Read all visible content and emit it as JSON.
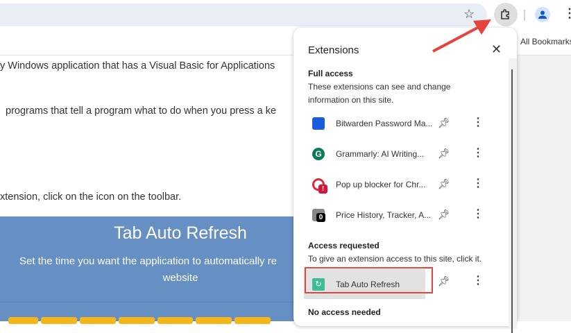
{
  "browser": {
    "bookmarks_label": "All Bookmarks"
  },
  "page": {
    "lines": [
      "y Windows application that has a Visual Basic for Applications",
      "programs that tell a program what to do when you press a ke",
      "xtension, click on the icon on the toolbar."
    ],
    "banner": {
      "title": "Tab Auto Refresh",
      "subtitle_line1": "Set the time you want the application to automatically re",
      "subtitle_line2": "website"
    }
  },
  "popup": {
    "title": "Extensions",
    "full_access": {
      "heading": "Full access",
      "description": "These extensions can see and change information on this site.",
      "items": [
        {
          "name": "Bitwarden Password Ma..."
        },
        {
          "name": "Grammarly: AI Writing..."
        },
        {
          "name": "Pop up blocker for Chr..."
        },
        {
          "name": "Price History, Tracker, A..."
        }
      ]
    },
    "access_requested": {
      "heading": "Access requested",
      "description": "To give an extension access to this site, click it.",
      "items": [
        {
          "name": "Tab Auto Refresh"
        }
      ]
    },
    "no_access": {
      "heading": "No access needed"
    },
    "badges": {
      "popup_blocker": "!",
      "price_history": "0"
    }
  },
  "colors": {
    "banner": "#668fc4",
    "highlight": "#e8423c",
    "accent": "#f4b619"
  }
}
